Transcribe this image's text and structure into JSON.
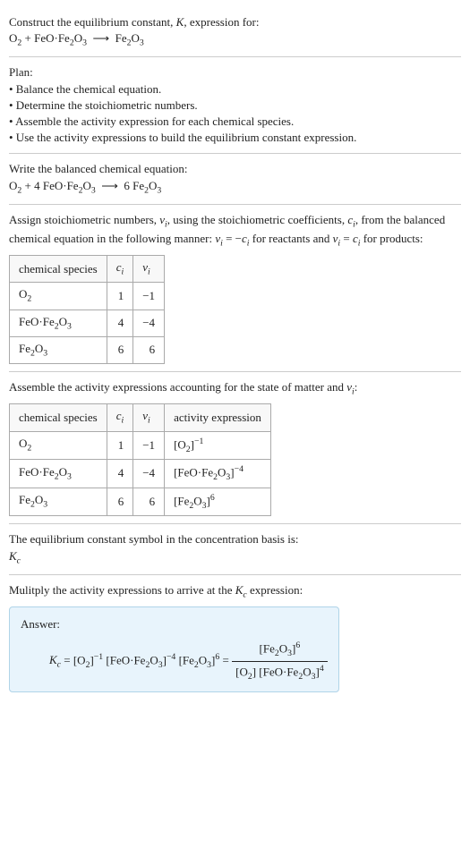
{
  "title": "Construct the equilibrium constant, K, expression for:",
  "equation_unbalanced": "O₂ + FeO·Fe₂O₃  ⟶  Fe₂O₃",
  "plan_label": "Plan:",
  "plan": [
    "• Balance the chemical equation.",
    "• Determine the stoichiometric numbers.",
    "• Assemble the activity expression for each chemical species.",
    "• Use the activity expressions to build the equilibrium constant expression."
  ],
  "balanced_label": "Write the balanced chemical equation:",
  "equation_balanced": "O₂ + 4 FeO·Fe₂O₃  ⟶  6 Fe₂O₃",
  "stoich_label": "Assign stoichiometric numbers, νᵢ, using the stoichiometric coefficients, cᵢ, from the balanced chemical equation in the following manner: νᵢ = −cᵢ for reactants and νᵢ = cᵢ for products:",
  "table1": {
    "headers": [
      "chemical species",
      "cᵢ",
      "νᵢ"
    ],
    "rows": [
      {
        "species": "O₂",
        "c": "1",
        "v": "−1"
      },
      {
        "species": "FeO·Fe₂O₃",
        "c": "4",
        "v": "−4"
      },
      {
        "species": "Fe₂O₃",
        "c": "6",
        "v": "6"
      }
    ]
  },
  "activity_label": "Assemble the activity expressions accounting for the state of matter and νᵢ:",
  "table2": {
    "headers": [
      "chemical species",
      "cᵢ",
      "νᵢ",
      "activity expression"
    ],
    "rows": [
      {
        "species": "O₂",
        "c": "1",
        "v": "−1",
        "ae": "[O₂]⁻¹"
      },
      {
        "species": "FeO·Fe₂O₃",
        "c": "4",
        "v": "−4",
        "ae": "[FeO·Fe₂O₃]⁻⁴"
      },
      {
        "species": "Fe₂O₃",
        "c": "6",
        "v": "6",
        "ae": "[Fe₂O₃]⁶"
      }
    ]
  },
  "basis_label": "The equilibrium constant symbol in the concentration basis is:",
  "basis_symbol": "K_c",
  "multiply_label": "Mulitply the activity expressions to arrive at the K_c expression:",
  "answer_label": "Answer:",
  "answer_expr_left": "K_c = [O₂]⁻¹ [FeO·Fe₂O₃]⁻⁴ [Fe₂O₃]⁶ = ",
  "answer_frac_top": "[Fe₂O₃]⁶",
  "answer_frac_bot": "[O₂] [FeO·Fe₂O₃]⁴",
  "chart_data": {
    "type": "table",
    "tables": [
      {
        "columns": [
          "chemical species",
          "c_i",
          "ν_i"
        ],
        "data": [
          [
            "O2",
            1,
            -1
          ],
          [
            "FeO·Fe2O3",
            4,
            -4
          ],
          [
            "Fe2O3",
            6,
            6
          ]
        ]
      },
      {
        "columns": [
          "chemical species",
          "c_i",
          "ν_i",
          "activity expression"
        ],
        "data": [
          [
            "O2",
            1,
            -1,
            "[O2]^-1"
          ],
          [
            "FeO·Fe2O3",
            4,
            -4,
            "[FeO·Fe2O3]^-4"
          ],
          [
            "Fe2O3",
            6,
            6,
            "[Fe2O3]^6"
          ]
        ]
      }
    ]
  }
}
